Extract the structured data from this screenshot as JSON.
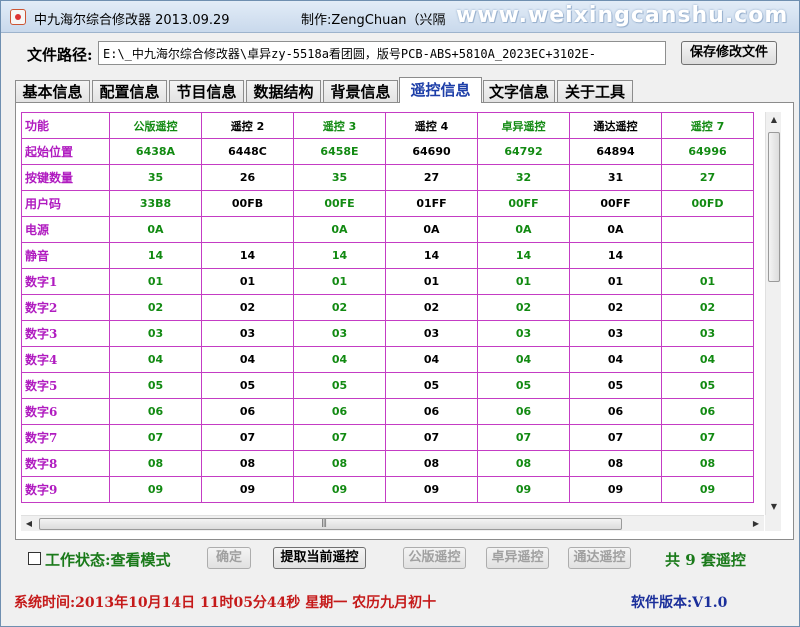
{
  "window": {
    "title": "中九海尔综合修改器 2013.09.29",
    "author": "制作:ZengChuan（兴隔",
    "watermark": "www.weixingcanshu.com"
  },
  "path": {
    "label": "文件路径:",
    "value": "E:\\_中九海尔综合修改器\\卓异zy-5518a看团圆，版号PCB-ABS+5810A_2023EC+3102E-",
    "save_label": "保存修改文件"
  },
  "tabs": [
    {
      "label": "基本信息"
    },
    {
      "label": "配置信息"
    },
    {
      "label": "节目信息"
    },
    {
      "label": "数据结构"
    },
    {
      "label": "背景信息"
    },
    {
      "label": "遥控信息"
    },
    {
      "label": "文字信息"
    },
    {
      "label": "关于工具"
    }
  ],
  "grid": {
    "columns": [
      "功能",
      "公版遥控",
      "遥控 2",
      "遥控 3",
      "遥控 4",
      "卓异遥控",
      "通达遥控",
      "遥控 7"
    ],
    "column_colors": [
      "",
      "green",
      "black",
      "green",
      "black",
      "green",
      "black",
      "green"
    ],
    "rows": [
      [
        "起始位置",
        "6438A",
        "6448C",
        "6458E",
        "64690",
        "64792",
        "64894",
        "64996"
      ],
      [
        "按键数量",
        "35",
        "26",
        "35",
        "27",
        "32",
        "31",
        "27"
      ],
      [
        "用户码",
        "33B8",
        "00FB",
        "00FE",
        "01FF",
        "00FF",
        "00FF",
        "00FD"
      ],
      [
        "电源",
        "0A",
        "",
        "0A",
        "0A",
        "0A",
        "0A",
        ""
      ],
      [
        "静音",
        "14",
        "14",
        "14",
        "14",
        "14",
        "14",
        ""
      ],
      [
        "数字1",
        "01",
        "01",
        "01",
        "01",
        "01",
        "01",
        "01"
      ],
      [
        "数字2",
        "02",
        "02",
        "02",
        "02",
        "02",
        "02",
        "02"
      ],
      [
        "数字3",
        "03",
        "03",
        "03",
        "03",
        "03",
        "03",
        "03"
      ],
      [
        "数字4",
        "04",
        "04",
        "04",
        "04",
        "04",
        "04",
        "04"
      ],
      [
        "数字5",
        "05",
        "05",
        "05",
        "05",
        "05",
        "05",
        "05"
      ],
      [
        "数字6",
        "06",
        "06",
        "06",
        "06",
        "06",
        "06",
        "06"
      ],
      [
        "数字7",
        "07",
        "07",
        "07",
        "07",
        "07",
        "07",
        "07"
      ],
      [
        "数字8",
        "08",
        "08",
        "08",
        "08",
        "08",
        "08",
        "08"
      ],
      [
        "数字9",
        "09",
        "09",
        "09",
        "09",
        "09",
        "09",
        "09"
      ]
    ]
  },
  "controls": {
    "work_status": "工作状态:查看模式",
    "confirm_label": "确定",
    "fetch_label": "提取当前遥控",
    "public_label": "公版遥控",
    "zhuoyi_label": "卓异遥控",
    "tongda_label": "通达遥控",
    "count_text": "共 9 套遥控"
  },
  "status": {
    "time_text": "系统时间:2013年10月14日   11时05分44秒   星期一    农历九月初十",
    "version_text": "软件版本:V1.0"
  },
  "colors": {
    "grid_border": "#c43cc4",
    "row_header": "#b01bc0",
    "green_value": "#128a12",
    "status_red": "#c51a1a",
    "version_blue": "#1b2f9b",
    "active_tab": "#1d3ea8"
  }
}
